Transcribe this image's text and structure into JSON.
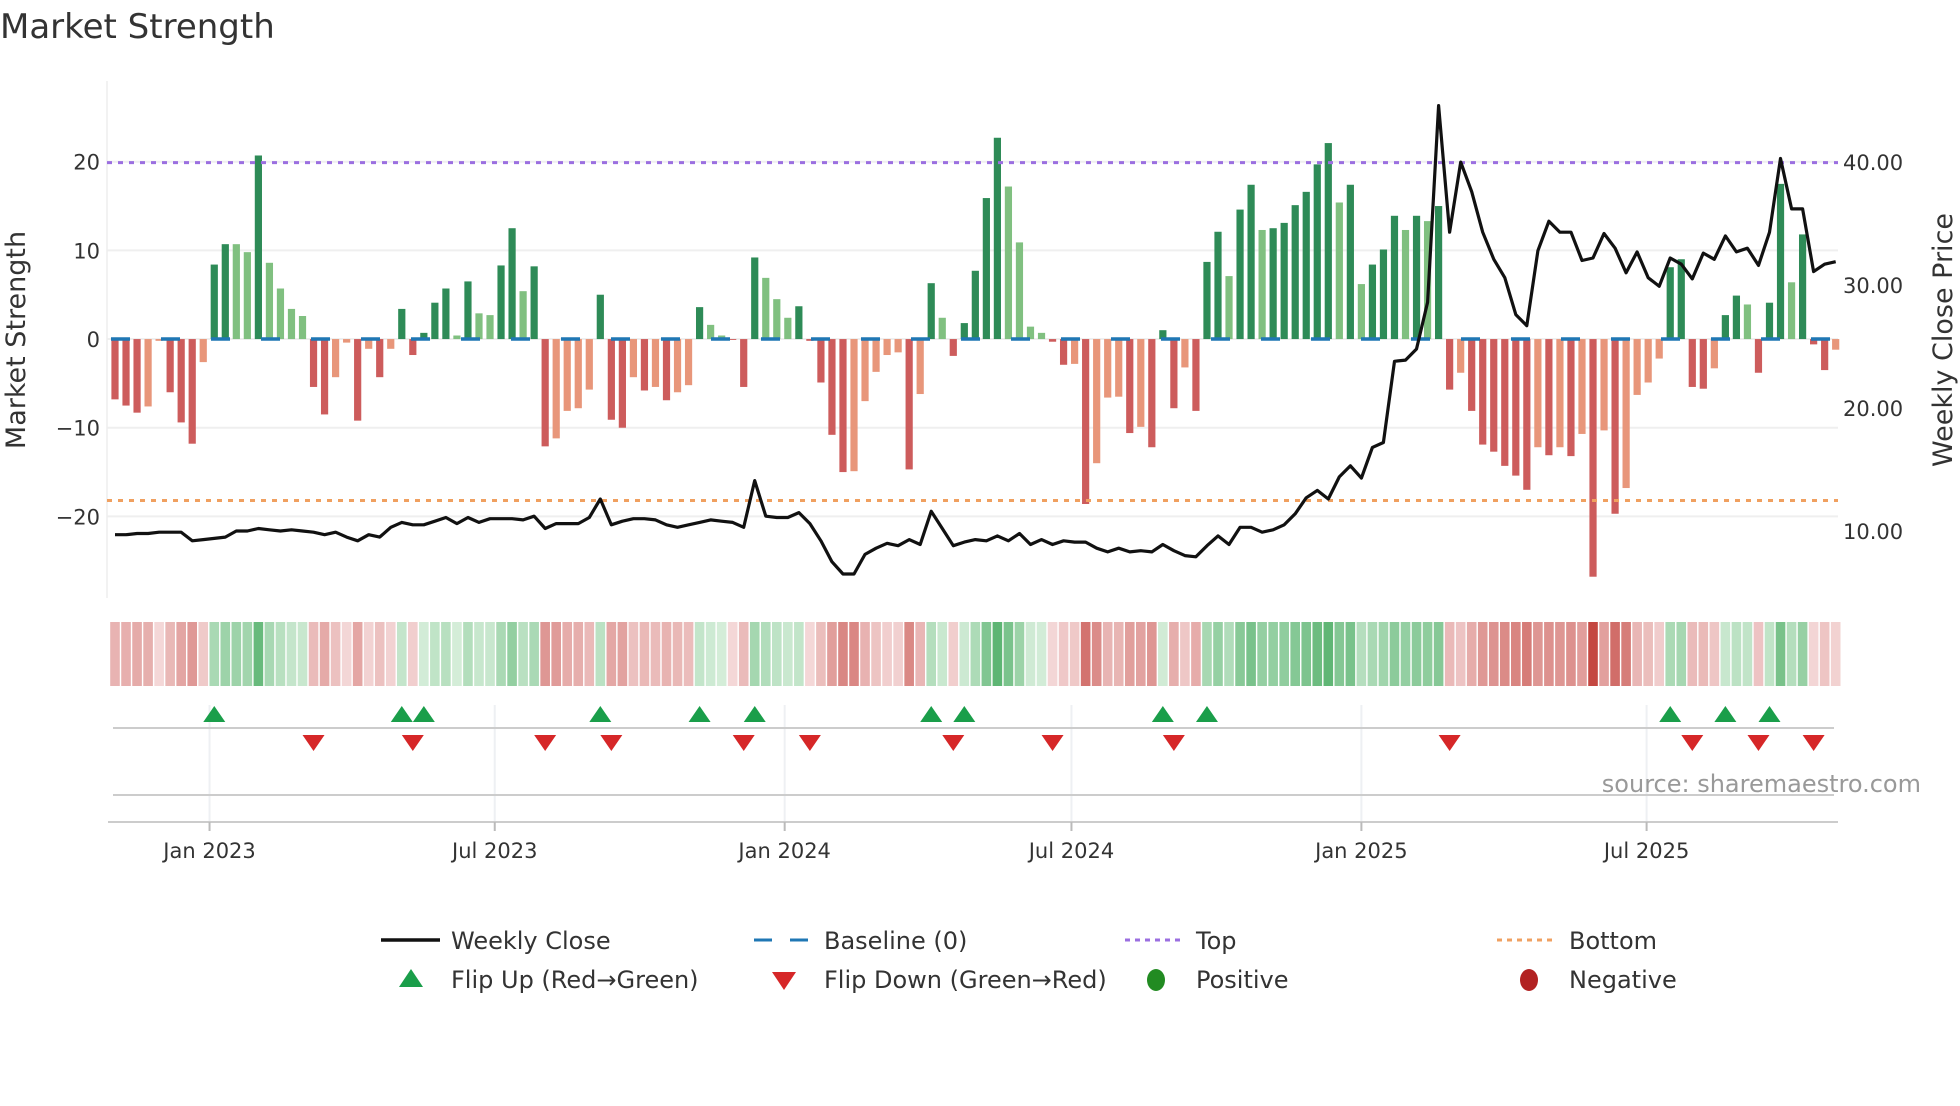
{
  "title": "Market Strength",
  "source": "source: sharemaestro.com",
  "colors": {
    "bar_strong_pos": "#2e8b57",
    "bar_weak_pos": "#80c080",
    "bar_strong_neg": "#cd5c5c",
    "bar_weak_neg": "#e8967a",
    "price": "#111111",
    "baseline": "#1f77b4",
    "top": "#9b6fe0",
    "bottom": "#f0a060",
    "flip_up": "#1a9e4a",
    "flip_down": "#d62728",
    "positive": "#228b22",
    "negative": "#b22222"
  },
  "legend": {
    "weekly_close": "Weekly Close",
    "baseline": "Baseline (0)",
    "top": "Top",
    "bottom": "Bottom",
    "flip_up": "Flip Up (Red→Green)",
    "flip_down": "Flip Down (Green→Red)",
    "positive": "Positive",
    "negative": "Negative"
  },
  "chart_data": {
    "type": "bar",
    "title": "Market Strength",
    "ylabel": "Market Strength",
    "y2label": "Weekly Close Price",
    "start_date": "2022-11-02",
    "frequency": "weekly",
    "ylim": [
      -29.2,
      29.1
    ],
    "y2lim": [
      4.55,
      46.6
    ],
    "yticks": [
      20,
      10,
      0,
      -10,
      -20
    ],
    "ytick_labels": [
      "20",
      "10",
      "0",
      "−10",
      "−20"
    ],
    "y2ticks": [
      40,
      30,
      20,
      10
    ],
    "y2tick_labels": [
      "40.00",
      "30.00",
      "20.00",
      "10.00"
    ],
    "xticks": [
      {
        "date": "2023-01-01",
        "label": "Jan 2023"
      },
      {
        "date": "2023-07-01",
        "label": "Jul 2023"
      },
      {
        "date": "2024-01-01",
        "label": "Jan 2024"
      },
      {
        "date": "2024-07-01",
        "label": "Jul 2024"
      },
      {
        "date": "2025-01-01",
        "label": "Jan 2025"
      },
      {
        "date": "2025-07-01",
        "label": "Jul 2025"
      }
    ],
    "top_level": 19.9,
    "bottom_level": -18.2,
    "baseline": 0,
    "strength": [
      -6.8,
      -7.5,
      -8.3,
      -7.6,
      -0.2,
      -6.0,
      -9.4,
      -11.8,
      -2.6,
      8.4,
      10.7,
      10.7,
      9.8,
      20.7,
      8.6,
      5.7,
      3.4,
      2.6,
      -5.4,
      -8.5,
      -4.3,
      -0.4,
      -9.2,
      -1.1,
      -4.3,
      -1.1,
      3.4,
      -1.8,
      0.7,
      4.1,
      5.7,
      0.4,
      6.5,
      2.9,
      2.7,
      8.3,
      12.5,
      5.4,
      8.2,
      -12.1,
      -11.2,
      -8.1,
      -7.8,
      -5.7,
      5.0,
      -9.1,
      -10.0,
      -4.3,
      -5.8,
      -5.4,
      -6.9,
      -6.0,
      -5.2,
      3.6,
      1.6,
      0.4,
      -0.1,
      -5.4,
      9.2,
      6.9,
      4.5,
      2.4,
      3.7,
      -0.2,
      -4.9,
      -10.8,
      -15.0,
      -14.9,
      -7.0,
      -3.7,
      -1.8,
      -1.5,
      -14.7,
      -6.2,
      6.3,
      2.4,
      -1.9,
      1.8,
      7.7,
      15.9,
      22.7,
      17.2,
      10.9,
      1.4,
      0.7,
      -0.3,
      -2.9,
      -2.8,
      -18.6,
      -14.0,
      -6.6,
      -6.5,
      -10.6,
      -9.9,
      -12.2,
      1.0,
      -7.8,
      -3.2,
      -8.1,
      8.7,
      12.1,
      7.1,
      14.6,
      17.4,
      12.3,
      12.5,
      13.1,
      15.1,
      16.6,
      19.7,
      22.1,
      15.4,
      17.4,
      6.2,
      8.4,
      10.1,
      13.9,
      12.3,
      13.9,
      13.3,
      15.0,
      -5.7,
      -3.8,
      -8.1,
      -11.9,
      -12.7,
      -14.3,
      -15.4,
      -17.0,
      -12.2,
      -13.1,
      -12.2,
      -13.2,
      -10.7,
      -26.8,
      -10.3,
      -19.7,
      -16.8,
      -6.3,
      -4.9,
      -2.2,
      8.1,
      9.0,
      -5.4,
      -5.6,
      -3.3,
      2.7,
      4.9,
      3.9,
      -3.8,
      4.1,
      17.5,
      6.4,
      11.8,
      -0.6,
      -3.5,
      -1.2
    ],
    "weekly_close": [
      9.7,
      9.7,
      9.8,
      9.8,
      9.9,
      9.9,
      9.9,
      9.2,
      9.3,
      9.4,
      9.5,
      10.0,
      10.0,
      10.2,
      10.1,
      10.0,
      10.1,
      10.0,
      9.9,
      9.7,
      9.9,
      9.5,
      9.2,
      9.7,
      9.5,
      10.3,
      10.7,
      10.5,
      10.5,
      10.8,
      11.1,
      10.6,
      11.1,
      10.7,
      11.0,
      11.0,
      11.0,
      10.9,
      11.2,
      10.2,
      10.6,
      10.6,
      10.6,
      11.1,
      12.6,
      10.5,
      10.8,
      11.0,
      11.0,
      10.9,
      10.5,
      10.3,
      10.5,
      10.7,
      10.9,
      10.8,
      10.7,
      10.3,
      14.1,
      11.2,
      11.1,
      11.1,
      11.5,
      10.6,
      9.2,
      7.5,
      6.5,
      6.5,
      8.1,
      8.6,
      9.0,
      8.8,
      9.3,
      8.9,
      11.6,
      10.2,
      8.8,
      9.1,
      9.3,
      9.2,
      9.6,
      9.2,
      9.8,
      8.9,
      9.3,
      8.9,
      9.2,
      9.1,
      9.1,
      8.6,
      8.3,
      8.6,
      8.3,
      8.4,
      8.3,
      8.9,
      8.4,
      8.0,
      7.9,
      8.8,
      9.6,
      8.9,
      10.3,
      10.3,
      9.9,
      10.1,
      10.5,
      11.4,
      12.7,
      13.3,
      12.6,
      14.4,
      15.3,
      14.3,
      16.8,
      17.2,
      23.8,
      23.9,
      24.8,
      28.6,
      44.6,
      34.3,
      40.0,
      37.6,
      34.3,
      32.1,
      30.6,
      27.6,
      26.7,
      32.8,
      35.2,
      34.3,
      34.3,
      32.0,
      32.2,
      34.2,
      33.0,
      31.0,
      32.7,
      30.6,
      29.9,
      32.2,
      31.7,
      30.5,
      32.6,
      32.1,
      34.0,
      32.7,
      33.0,
      31.6,
      34.3,
      40.3,
      36.2,
      36.2,
      31.1,
      31.7,
      31.9
    ],
    "flip_up_weeks": [
      9,
      26,
      28,
      44,
      53,
      58,
      74,
      77,
      95,
      99,
      141,
      146,
      150
    ],
    "flip_down_weeks": [
      18,
      27,
      39,
      45,
      57,
      63,
      76,
      85,
      96,
      121,
      143,
      149,
      154
    ],
    "legend_position": "bottom"
  }
}
